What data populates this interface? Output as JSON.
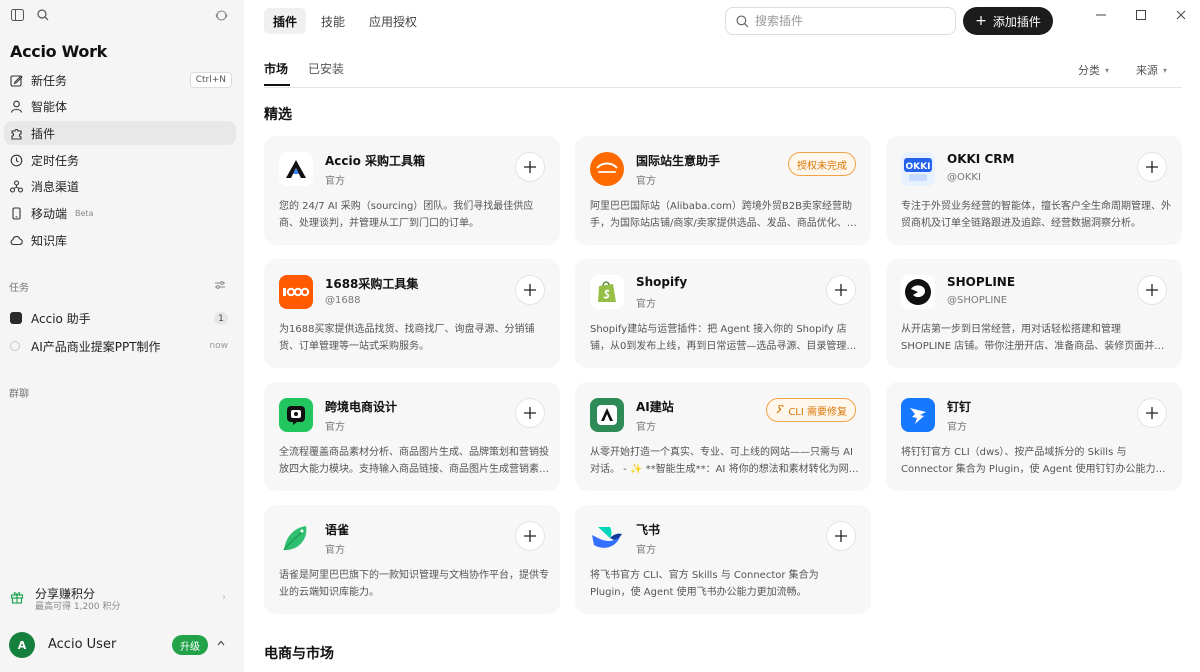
{
  "app": {
    "name": "Accio Work"
  },
  "sidebar": {
    "nav": [
      {
        "label": "新任务",
        "icon": "edit-icon",
        "shortcut": "Ctrl+N"
      },
      {
        "label": "智能体",
        "icon": "user-icon"
      },
      {
        "label": "插件",
        "icon": "puzzle-icon",
        "active": true
      },
      {
        "label": "定时任务",
        "icon": "clock-icon"
      },
      {
        "label": "消息渠道",
        "icon": "channels-icon"
      },
      {
        "label": "移动端",
        "icon": "mobile-icon",
        "badge": "Beta"
      },
      {
        "label": "知识库",
        "icon": "cloud-icon"
      }
    ],
    "tasks_label": "任务",
    "tasks": [
      {
        "title": "Accio 助手",
        "count": "1"
      },
      {
        "title": "AI产品商业提案PPT制作",
        "time": "now"
      }
    ],
    "group_label": "群聊",
    "share": {
      "title": "分享赚积分",
      "subtitle": "最高可得 1,200 积分"
    },
    "user": {
      "initial": "A",
      "name": "Accio User",
      "upgrade": "升级"
    }
  },
  "header": {
    "tabs": [
      "插件",
      "技能",
      "应用授权"
    ],
    "search_placeholder": "搜索插件",
    "add_label": "添加插件"
  },
  "subtabs": [
    "市场",
    "已安装"
  ],
  "filters": [
    "分类",
    "来源"
  ],
  "sections": {
    "featured": "精选",
    "ecommerce": "电商与市场"
  },
  "plugins": [
    {
      "name": "Accio 采购工具箱",
      "publisher": "官方",
      "desc": "您的 24/7 AI 采购（sourcing）团队。我们寻找最佳供应商、处理谈判，并管理从工厂到门口的订单。",
      "logo": "accio-logo"
    },
    {
      "name": "国际站生意助手",
      "publisher": "官方",
      "desc": "阿里巴巴国际站（Alibaba.com）跨境外贸B2B卖家经营助手，为国际站店铺/商家/卖家提供选品、发品、商品优化、营销推广、数据分析等服务。",
      "tag": "授权未完成",
      "logo": "alibaba-logo"
    },
    {
      "name": "OKKI CRM",
      "publisher": "@OKKI",
      "desc": "专注于外贸业务经营的智能体，擅长客户全生命周期管理、外贸商机及订单全链路跟进及追踪、经营数据洞察分析。",
      "logo": "okki-logo"
    },
    {
      "name": "1688采购工具集",
      "publisher": "@1688",
      "desc": "为1688买家提供选品找货、找商找厂、询盘寻源、分销铺货、订单管理等一站式采购服务。",
      "logo": "1688-logo"
    },
    {
      "name": "Shopify",
      "publisher": "官方",
      "desc": "Shopify建站与运营插件：把 Agent 接入你的 Shopify 店铺，从0到发布上线，再到日常运营—选品寻源、目录管理与营销。",
      "logo": "shopify-logo"
    },
    {
      "name": "SHOPLINE",
      "publisher": "@SHOPLINE",
      "desc": "从开店第一步到日常经营，用对话轻松搭建和管理 SHOPLINE 店铺。带你注册开店、准备商品、装修页面并上线。",
      "logo": "shopline-logo"
    },
    {
      "name": "跨境电商设计",
      "publisher": "官方",
      "desc": "全流程覆盖商品素材分析、商品图片生成、品牌策划和营销投放四大能力模块。支持输入商品链接、商品图片生成营销素材。",
      "logo": "design-logo"
    },
    {
      "name": "AI建站",
      "publisher": "官方",
      "desc": "从零开始打造一个真实、专业、可上线的网站——只需与 AI 对话。 - ✨ **智能生成**：AI 将你的想法和素材转化为网站。",
      "tag": "CLI 需要修复",
      "logo": "aisite-logo"
    },
    {
      "name": "钉钉",
      "publisher": "官方",
      "desc": "将钉钉官方 CLI（dws）、按产品域拆分的 Skills 与 Connector 集合为 Plugin，使 Agent 使用钉钉办公能力更加流畅。",
      "logo": "dingtalk-logo"
    },
    {
      "name": "语雀",
      "publisher": "官方",
      "desc": "语雀是阿里巴巴旗下的一款知识管理与文档协作平台，提供专业的云端知识库能力。",
      "logo": "yuque-logo"
    },
    {
      "name": "飞书",
      "publisher": "官方",
      "desc": "将飞书官方 CLI、官方 Skills 与 Connector 集合为 Plugin，使 Agent 使用飞书办公能力更加流畅。",
      "logo": "feishu-logo"
    }
  ],
  "colors": {
    "accent_dark": "#1c1c1c",
    "upgrade_green": "#22a34a",
    "warning_orange": "#d97706"
  }
}
